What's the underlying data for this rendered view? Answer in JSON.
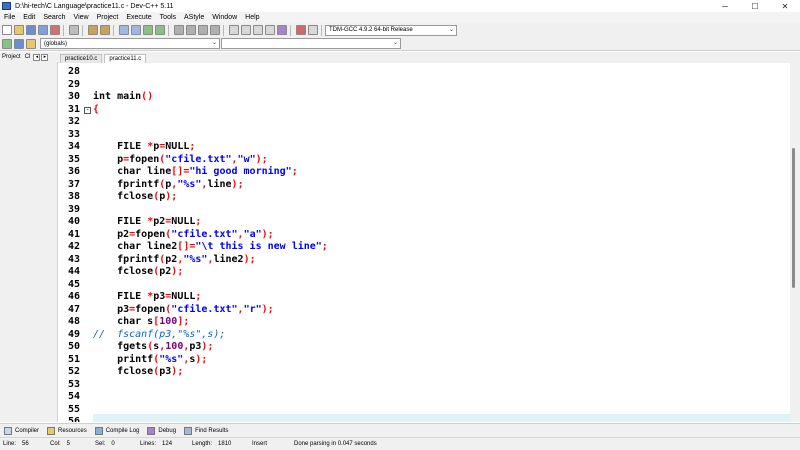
{
  "window": {
    "title": "D:\\hi-tech\\C Language\\practice11.c - Dev-C++ 5.11",
    "minimize_glyph": "─",
    "maximize_glyph": "☐",
    "close_glyph": "✕"
  },
  "menu": [
    "File",
    "Edit",
    "Search",
    "View",
    "Project",
    "Execute",
    "Tools",
    "AStyle",
    "Window",
    "Help"
  ],
  "toolbar": {
    "compiler_select": "TDM-GCC 4.9.2 64-bit Release",
    "scope_select": "(globals)",
    "function_select": ""
  },
  "left_panel": {
    "tabs": [
      "Project",
      "Cl"
    ],
    "prev_arrow": "◂",
    "next_arrow": "▸"
  },
  "editor": {
    "tabs": [
      "practice10.c",
      "practice11.c"
    ],
    "active_tab": "practice11.c",
    "fold_glyph": "-",
    "lines": [
      {
        "n": "28",
        "t": []
      },
      {
        "n": "29",
        "t": []
      },
      {
        "n": "30",
        "t": [
          [
            "id",
            "int main"
          ],
          [
            "sym",
            "()"
          ]
        ]
      },
      {
        "n": "31",
        "t": [
          [
            "sym",
            "{"
          ]
        ],
        "fold": true
      },
      {
        "n": "32",
        "t": []
      },
      {
        "n": "33",
        "t": []
      },
      {
        "n": "34",
        "t": [
          [
            "id",
            "    FILE "
          ],
          [
            "sym",
            "*"
          ],
          [
            "id",
            "p"
          ],
          [
            "sym",
            "="
          ],
          [
            "id",
            "NULL"
          ],
          [
            "sym",
            ";"
          ]
        ]
      },
      {
        "n": "35",
        "t": [
          [
            "id",
            "    p"
          ],
          [
            "sym",
            "="
          ],
          [
            "id",
            "fopen"
          ],
          [
            "sym",
            "("
          ],
          [
            "str",
            "\"cfile.txt\""
          ],
          [
            "sym",
            ","
          ],
          [
            "str",
            "\"w\""
          ],
          [
            "sym",
            ");"
          ]
        ]
      },
      {
        "n": "36",
        "t": [
          [
            "id",
            "    char line"
          ],
          [
            "sym",
            "[]="
          ],
          [
            "str",
            "\"hi good morning\""
          ],
          [
            "sym",
            ";"
          ]
        ]
      },
      {
        "n": "37",
        "t": [
          [
            "id",
            "    fprintf"
          ],
          [
            "sym",
            "("
          ],
          [
            "id",
            "p"
          ],
          [
            "sym",
            ","
          ],
          [
            "str",
            "\"%s\""
          ],
          [
            "sym",
            ","
          ],
          [
            "id",
            "line"
          ],
          [
            "sym",
            ");"
          ]
        ]
      },
      {
        "n": "38",
        "t": [
          [
            "id",
            "    fclose"
          ],
          [
            "sym",
            "("
          ],
          [
            "id",
            "p"
          ],
          [
            "sym",
            ");"
          ]
        ]
      },
      {
        "n": "39",
        "t": []
      },
      {
        "n": "40",
        "t": [
          [
            "id",
            "    FILE "
          ],
          [
            "sym",
            "*"
          ],
          [
            "id",
            "p2"
          ],
          [
            "sym",
            "="
          ],
          [
            "id",
            "NULL"
          ],
          [
            "sym",
            ";"
          ]
        ]
      },
      {
        "n": "41",
        "t": [
          [
            "id",
            "    p2"
          ],
          [
            "sym",
            "="
          ],
          [
            "id",
            "fopen"
          ],
          [
            "sym",
            "("
          ],
          [
            "str",
            "\"cfile.txt\""
          ],
          [
            "sym",
            ","
          ],
          [
            "str",
            "\"a\""
          ],
          [
            "sym",
            ");"
          ]
        ]
      },
      {
        "n": "42",
        "t": [
          [
            "id",
            "    char line2"
          ],
          [
            "sym",
            "[]="
          ],
          [
            "str",
            "\"\\t this is new line\""
          ],
          [
            "sym",
            ";"
          ]
        ]
      },
      {
        "n": "43",
        "t": [
          [
            "id",
            "    fprintf"
          ],
          [
            "sym",
            "("
          ],
          [
            "id",
            "p2"
          ],
          [
            "sym",
            ","
          ],
          [
            "str",
            "\"%s\""
          ],
          [
            "sym",
            ","
          ],
          [
            "id",
            "line2"
          ],
          [
            "sym",
            ");"
          ]
        ]
      },
      {
        "n": "44",
        "t": [
          [
            "id",
            "    fclose"
          ],
          [
            "sym",
            "("
          ],
          [
            "id",
            "p2"
          ],
          [
            "sym",
            ");"
          ]
        ]
      },
      {
        "n": "45",
        "t": []
      },
      {
        "n": "46",
        "t": [
          [
            "id",
            "    FILE "
          ],
          [
            "sym",
            "*"
          ],
          [
            "id",
            "p3"
          ],
          [
            "sym",
            "="
          ],
          [
            "id",
            "NULL"
          ],
          [
            "sym",
            ";"
          ]
        ]
      },
      {
        "n": "47",
        "t": [
          [
            "id",
            "    p3"
          ],
          [
            "sym",
            "="
          ],
          [
            "id",
            "fopen"
          ],
          [
            "sym",
            "("
          ],
          [
            "str",
            "\"cfile.txt\""
          ],
          [
            "sym",
            ","
          ],
          [
            "str",
            "\"r\""
          ],
          [
            "sym",
            ");"
          ]
        ]
      },
      {
        "n": "48",
        "t": [
          [
            "id",
            "    char s"
          ],
          [
            "sym",
            "["
          ],
          [
            "num",
            "100"
          ],
          [
            "sym",
            "];"
          ]
        ]
      },
      {
        "n": "49",
        "t": [
          [
            "cmt",
            "//  fscanf(p3,\"%s\",s);"
          ]
        ]
      },
      {
        "n": "50",
        "t": [
          [
            "id",
            "    fgets"
          ],
          [
            "sym",
            "("
          ],
          [
            "id",
            "s"
          ],
          [
            "sym",
            ","
          ],
          [
            "num",
            "100"
          ],
          [
            "sym",
            ","
          ],
          [
            "id",
            "p3"
          ],
          [
            "sym",
            ");"
          ]
        ]
      },
      {
        "n": "51",
        "t": [
          [
            "id",
            "    printf"
          ],
          [
            "sym",
            "("
          ],
          [
            "str",
            "\"%s\""
          ],
          [
            "sym",
            ","
          ],
          [
            "id",
            "s"
          ],
          [
            "sym",
            ");"
          ]
        ]
      },
      {
        "n": "52",
        "t": [
          [
            "id",
            "    fclose"
          ],
          [
            "sym",
            "("
          ],
          [
            "id",
            "p3"
          ],
          [
            "sym",
            ");"
          ]
        ]
      },
      {
        "n": "53",
        "t": []
      },
      {
        "n": "54",
        "t": []
      },
      {
        "n": "55",
        "t": []
      },
      {
        "n": "56",
        "t": []
      }
    ]
  },
  "bottom_tabs": [
    {
      "label": "Compiler",
      "icon": "grid-icon"
    },
    {
      "label": "Resources",
      "icon": "resources-icon"
    },
    {
      "label": "Compile Log",
      "icon": "chart-icon"
    },
    {
      "label": "Debug",
      "icon": "check-icon"
    },
    {
      "label": "Find Results",
      "icon": "find-icon"
    }
  ],
  "status": {
    "line_label": "Line:",
    "line": "56",
    "col_label": "Col:",
    "col": "5",
    "sel_label": "Sel:",
    "sel": "0",
    "lines_label": "Lines:",
    "lines": "124",
    "length_label": "Length:",
    "length": "1810",
    "mode": "Insert",
    "message": "Done parsing in 0.047 seconds"
  },
  "colors": {
    "string": "#0000ff",
    "symbol": "#ff0000",
    "number": "#800080",
    "comment": "#0066cc"
  }
}
